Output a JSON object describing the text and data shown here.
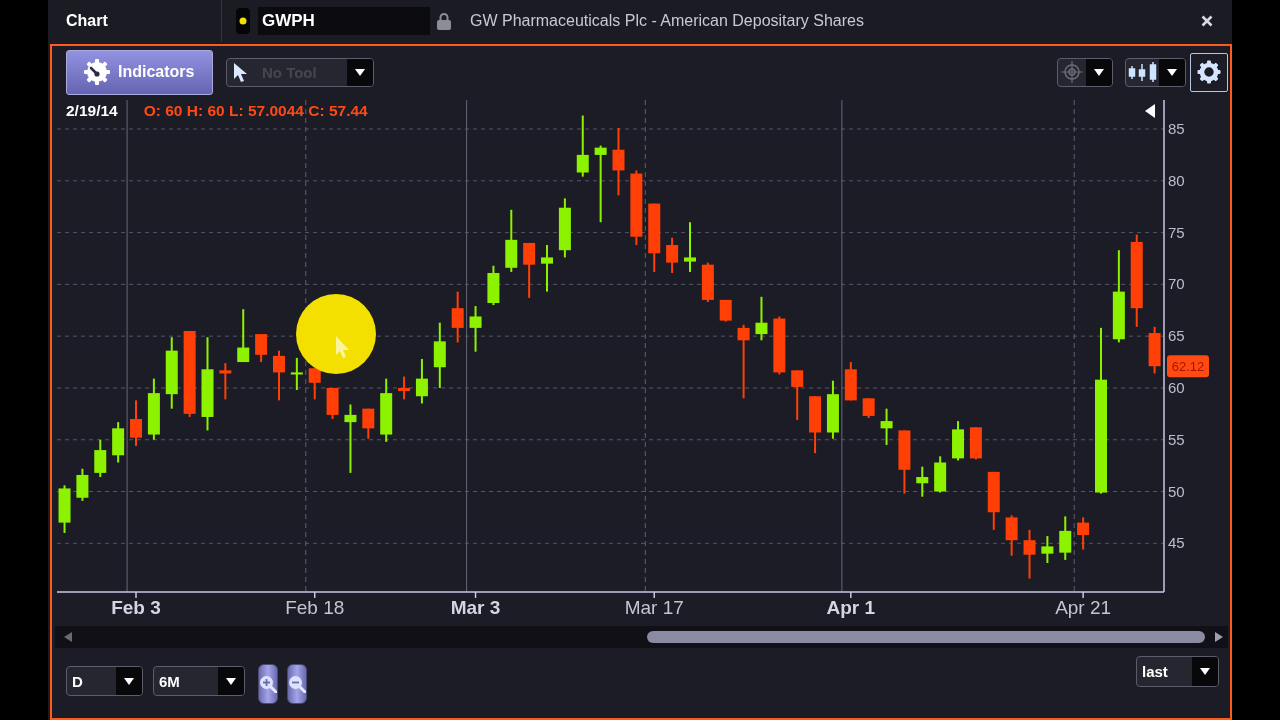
{
  "header": {
    "title": "Chart",
    "symbol": "GWPH",
    "description": "GW Pharmaceuticals Plc - American Depositary Shares"
  },
  "toolbar": {
    "indicators_label": "Indicators",
    "tool_select": {
      "value": "No Tool",
      "disabled": true
    }
  },
  "chart": {
    "readout": {
      "date": "2/19/14",
      "values": "O: 60 H: 60 L: 57.0044 C: 57.44"
    },
    "x_tick_bold": [
      true,
      false,
      true,
      false,
      true,
      false
    ],
    "chart_data": {
      "type": "candlestick",
      "categories": [
        null,
        null,
        null,
        null,
        "Feb 3",
        null,
        null,
        null,
        null,
        null,
        null,
        null,
        null,
        null,
        "Feb 18",
        null,
        null,
        null,
        null,
        null,
        null,
        null,
        null,
        "Mar 3",
        null,
        null,
        null,
        null,
        null,
        null,
        null,
        null,
        null,
        "Mar 17",
        null,
        null,
        null,
        null,
        null,
        null,
        null,
        null,
        null,
        null,
        "Apr 1",
        null,
        null,
        null,
        null,
        null,
        null,
        null,
        null,
        null,
        null,
        null,
        null,
        "Apr 21",
        null,
        null,
        null,
        null
      ],
      "ohlc": [
        [
          47.0,
          50.6,
          46.0,
          50.3
        ],
        [
          49.4,
          52.2,
          49.1,
          51.6
        ],
        [
          51.8,
          55.0,
          51.4,
          54.0
        ],
        [
          53.5,
          56.7,
          52.8,
          56.1
        ],
        [
          57.0,
          58.8,
          54.4,
          55.2
        ],
        [
          55.5,
          60.9,
          55.0,
          59.5
        ],
        [
          59.4,
          64.9,
          58.0,
          63.6
        ],
        [
          65.5,
          65.5,
          57.2,
          57.5
        ],
        [
          57.2,
          64.9,
          55.9,
          61.8
        ],
        [
          61.7,
          62.4,
          58.9,
          61.4
        ],
        [
          62.5,
          67.6,
          62.5,
          63.9
        ],
        [
          65.2,
          65.2,
          62.5,
          63.2
        ],
        [
          63.1,
          63.6,
          58.8,
          61.5
        ],
        [
          61.3,
          62.9,
          59.8,
          61.5
        ],
        [
          61.9,
          61.9,
          58.9,
          60.5
        ],
        [
          60.0,
          60.0,
          57.0,
          57.4
        ],
        [
          56.7,
          58.4,
          51.8,
          57.4
        ],
        [
          58.0,
          58.0,
          55.1,
          56.1
        ],
        [
          55.5,
          60.9,
          54.8,
          59.5
        ],
        [
          60.0,
          61.1,
          58.9,
          59.7
        ],
        [
          59.2,
          62.8,
          58.5,
          60.9
        ],
        [
          62.0,
          66.3,
          60.0,
          64.5
        ],
        [
          67.7,
          69.3,
          64.4,
          65.8
        ],
        [
          65.8,
          67.9,
          63.5,
          66.9
        ],
        [
          68.2,
          71.8,
          68.0,
          71.1
        ],
        [
          71.6,
          77.2,
          71.2,
          74.3
        ],
        [
          74.0,
          74.0,
          68.7,
          71.9
        ],
        [
          72.0,
          73.8,
          69.3,
          72.6
        ],
        [
          73.3,
          78.3,
          72.6,
          77.4
        ],
        [
          80.8,
          86.3,
          80.4,
          82.5
        ],
        [
          82.5,
          83.4,
          76.0,
          83.2
        ],
        [
          83.0,
          85.1,
          78.6,
          81.0
        ],
        [
          80.7,
          81.0,
          73.8,
          74.6
        ],
        [
          77.8,
          77.8,
          71.2,
          73.0
        ],
        [
          73.8,
          74.5,
          71.1,
          72.1
        ],
        [
          72.2,
          76.0,
          71.2,
          72.6
        ],
        [
          71.9,
          72.1,
          68.3,
          68.5
        ],
        [
          68.5,
          68.5,
          66.4,
          66.5
        ],
        [
          65.8,
          66.1,
          59.0,
          64.6
        ],
        [
          65.2,
          68.8,
          64.6,
          66.3
        ],
        [
          66.7,
          66.9,
          61.3,
          61.5
        ],
        [
          61.7,
          61.7,
          56.9,
          60.1
        ],
        [
          59.2,
          59.2,
          53.7,
          55.7
        ],
        [
          55.7,
          60.7,
          55.1,
          59.4
        ],
        [
          61.8,
          62.5,
          58.8,
          58.8
        ],
        [
          59.0,
          59.0,
          57.1,
          57.3
        ],
        [
          56.1,
          58.0,
          54.5,
          56.8
        ],
        [
          55.9,
          55.9,
          49.8,
          52.1
        ],
        [
          50.8,
          52.4,
          49.5,
          51.4
        ],
        [
          50.0,
          53.4,
          49.9,
          52.8
        ],
        [
          53.2,
          56.8,
          53.0,
          56.0
        ],
        [
          56.2,
          56.2,
          53.1,
          53.2
        ],
        [
          51.9,
          51.9,
          46.3,
          48.0
        ],
        [
          47.5,
          47.7,
          43.8,
          45.3
        ],
        [
          45.3,
          46.3,
          41.6,
          43.9
        ],
        [
          44.0,
          45.7,
          43.1,
          44.7
        ],
        [
          44.1,
          47.6,
          43.4,
          46.2
        ],
        [
          47.0,
          47.5,
          44.4,
          45.8
        ],
        [
          49.9,
          65.8,
          49.8,
          60.8
        ],
        [
          64.7,
          73.3,
          64.4,
          69.3
        ],
        [
          74.1,
          74.8,
          65.9,
          67.7
        ],
        [
          65.3,
          65.9,
          61.4,
          62.1
        ]
      ],
      "ylim": [
        40.3,
        87.8
      ],
      "yticks": [
        45,
        50,
        55,
        60,
        65,
        70,
        75,
        80,
        85
      ],
      "grid": true,
      "annotations": [
        "62.12"
      ]
    }
  },
  "footer": {
    "interval": "D",
    "range": "6M",
    "price_field": "last"
  }
}
